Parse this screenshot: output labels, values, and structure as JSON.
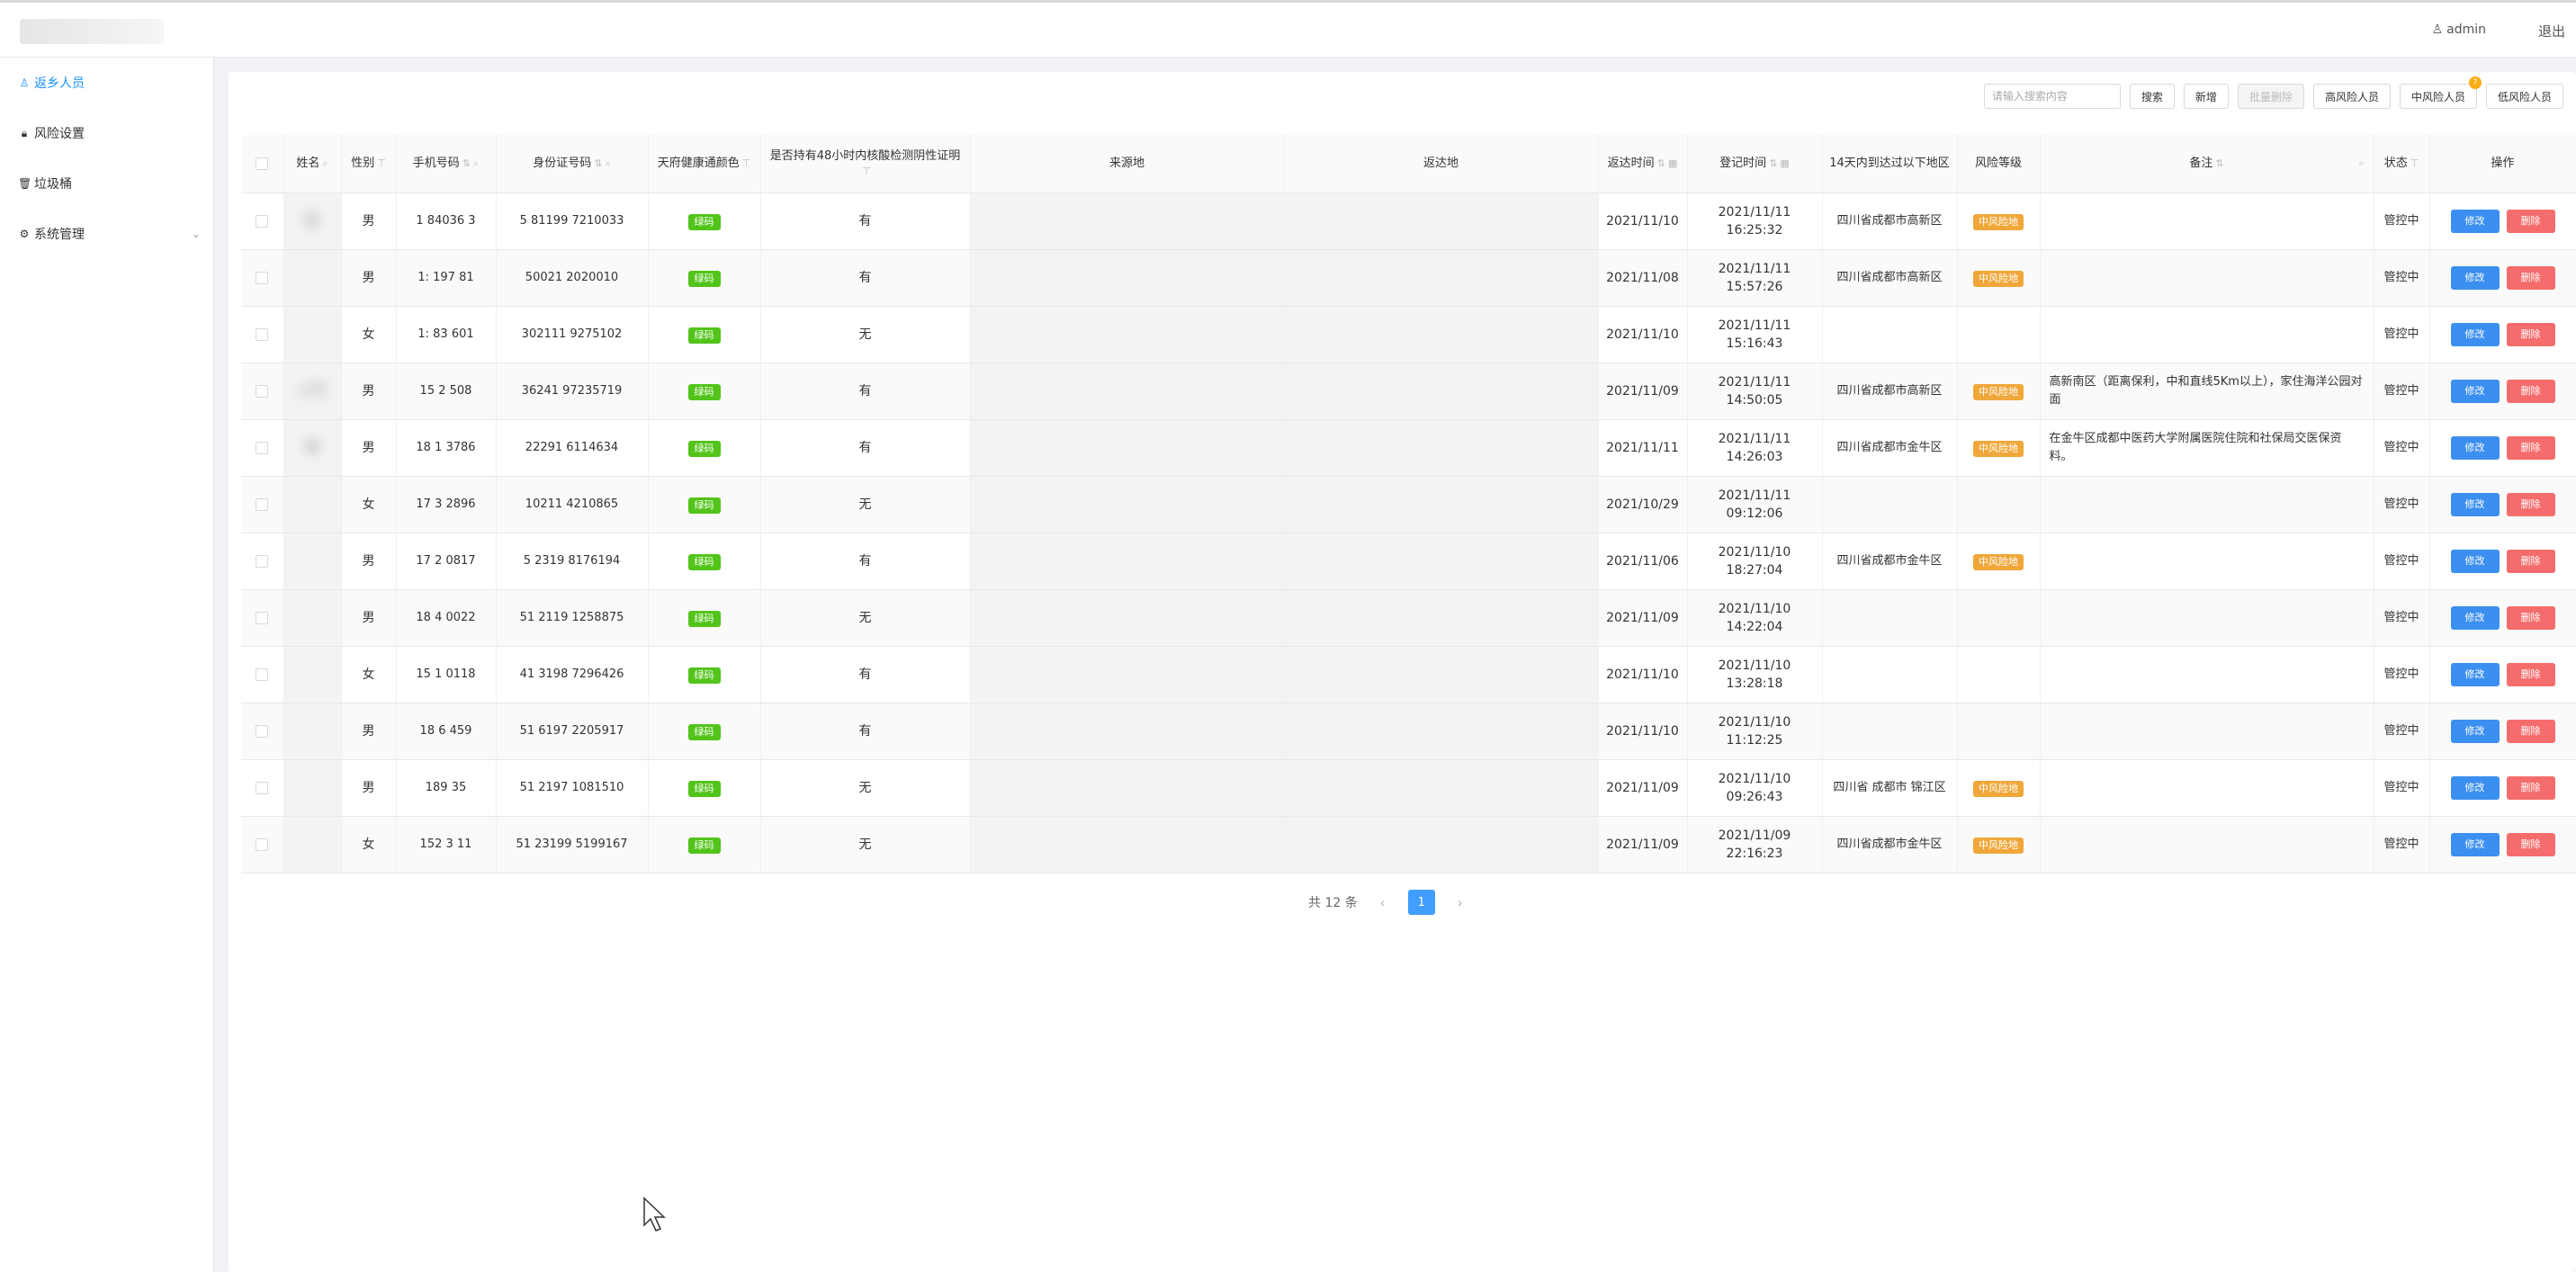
{
  "topbar": {
    "username": "admin",
    "logout": "退出"
  },
  "sidebar": {
    "items": [
      {
        "label": "返乡人员",
        "icon": "user-icon",
        "active": true
      },
      {
        "label": "风险设置",
        "icon": "lock-icon",
        "active": false
      },
      {
        "label": "垃圾桶",
        "icon": "trash-icon",
        "active": false
      },
      {
        "label": "系统管理",
        "icon": "gear-icon",
        "active": false
      }
    ]
  },
  "toolbar": {
    "search_placeholder": "请输入搜索内容",
    "search": "搜索",
    "add": "新增",
    "batch_delete": "批量删除",
    "high_risk": "高风险人员",
    "mid_risk": "中风险人员",
    "mid_risk_badge": "?",
    "low_risk": "低风险人员"
  },
  "table": {
    "headers": {
      "name": "姓名",
      "gender": "性别",
      "phone": "手机号码",
      "id": "身份证号码",
      "health": "天府健康通颜色",
      "test": "是否持有48小时内核酸检测阴性证明",
      "from": "来源地",
      "to": "返达地",
      "return_time": "返达时间",
      "reg_time": "登记时间",
      "region": "14天内到达过以下地区",
      "risk": "风险等级",
      "note": "备注",
      "status": "状态",
      "action": "操作"
    },
    "rows": [
      {
        "name": "彭",
        "gender": "男",
        "phone": "1 84036 3",
        "id": "5 81199 7210033",
        "health": "绿码",
        "test": "有",
        "return": "2021/11/10",
        "reg_date": "2021/11/11",
        "reg_time": "16:25:32",
        "region": "四川省成都市高新区",
        "risk": "中风险地",
        "note": "",
        "status": "管控中"
      },
      {
        "name": "",
        "gender": "男",
        "phone": "1: 197 81",
        "id": "50021 2020010",
        "health": "绿码",
        "test": "有",
        "return": "2021/11/08",
        "reg_date": "2021/11/11",
        "reg_time": "15:57:26",
        "region": "四川省成都市高新区",
        "risk": "中风险地",
        "note": "",
        "status": "管控中"
      },
      {
        "name": "",
        "gender": "女",
        "phone": "1: 83 601",
        "id": "302111 9275102",
        "health": "绿码",
        "test": "无",
        "return": "2021/11/10",
        "reg_date": "2021/11/11",
        "reg_time": "15:16:43",
        "region": "",
        "risk": "",
        "note": "",
        "status": "管控中"
      },
      {
        "name": "1 鬥",
        "gender": "男",
        "phone": "15 2 508",
        "id": "36241 97235719",
        "health": "绿码",
        "test": "有",
        "return": "2021/11/09",
        "reg_date": "2021/11/11",
        "reg_time": "14:50:05",
        "region": "四川省成都市高新区",
        "risk": "中风险地",
        "note": "高新南区（距离保利，中和直线5Km以上），家住海洋公园对面",
        "status": "管控中"
      },
      {
        "name": "寿",
        "gender": "男",
        "phone": "18 1 3786",
        "id": "22291 6114634",
        "health": "绿码",
        "test": "有",
        "return": "2021/11/11",
        "reg_date": "2021/11/11",
        "reg_time": "14:26:03",
        "region": "四川省成都市金牛区",
        "risk": "中风险地",
        "note": "在金牛区成都中医药大学附属医院住院和社保局交医保资料。",
        "status": "管控中"
      },
      {
        "name": "",
        "gender": "女",
        "phone": "17 3 2896",
        "id": "10211 4210865",
        "health": "绿码",
        "test": "无",
        "return": "2021/10/29",
        "reg_date": "2021/11/11",
        "reg_time": "09:12:06",
        "region": "",
        "risk": "",
        "note": "",
        "status": "管控中"
      },
      {
        "name": "",
        "gender": "男",
        "phone": "17 2 0817",
        "id": "5 2319 8176194",
        "health": "绿码",
        "test": "有",
        "return": "2021/11/06",
        "reg_date": "2021/11/10",
        "reg_time": "18:27:04",
        "region": "四川省成都市金牛区",
        "risk": "中风险地",
        "note": "",
        "status": "管控中"
      },
      {
        "name": "",
        "gender": "男",
        "phone": "18 4 0022",
        "id": "51 2119 1258875",
        "health": "绿码",
        "test": "无",
        "return": "2021/11/09",
        "reg_date": "2021/11/10",
        "reg_time": "14:22:04",
        "region": "",
        "risk": "",
        "note": "",
        "status": "管控中"
      },
      {
        "name": "",
        "gender": "女",
        "phone": "15 1 0118",
        "id": "41 3198 7296426",
        "health": "绿码",
        "test": "有",
        "return": "2021/11/10",
        "reg_date": "2021/11/10",
        "reg_time": "13:28:18",
        "region": "",
        "risk": "",
        "note": "",
        "status": "管控中"
      },
      {
        "name": "",
        "gender": "男",
        "phone": "18 6 459",
        "id": "51 6197 2205917",
        "health": "绿码",
        "test": "有",
        "return": "2021/11/10",
        "reg_date": "2021/11/10",
        "reg_time": "11:12:25",
        "region": "",
        "risk": "",
        "note": "",
        "status": "管控中"
      },
      {
        "name": "",
        "gender": "男",
        "phone": "189 35",
        "id": "51 2197 1081510",
        "health": "绿码",
        "test": "无",
        "return": "2021/11/09",
        "reg_date": "2021/11/10",
        "reg_time": "09:26:43",
        "region": "四川省 成都市 锦江区",
        "risk": "中风险地",
        "note": "",
        "status": "管控中"
      },
      {
        "name": "",
        "gender": "女",
        "phone": "152 3 11",
        "id": "51 23199 5199167",
        "health": "绿码",
        "test": "无",
        "return": "2021/11/09",
        "reg_date": "2021/11/09",
        "reg_time": "22:16:23",
        "region": "四川省成都市金牛区",
        "risk": "中风险地",
        "note": "",
        "status": "管控中"
      }
    ],
    "edit_label": "修改",
    "delete_label": "删除"
  },
  "pagination": {
    "total": "共 12 条",
    "page": "1"
  }
}
